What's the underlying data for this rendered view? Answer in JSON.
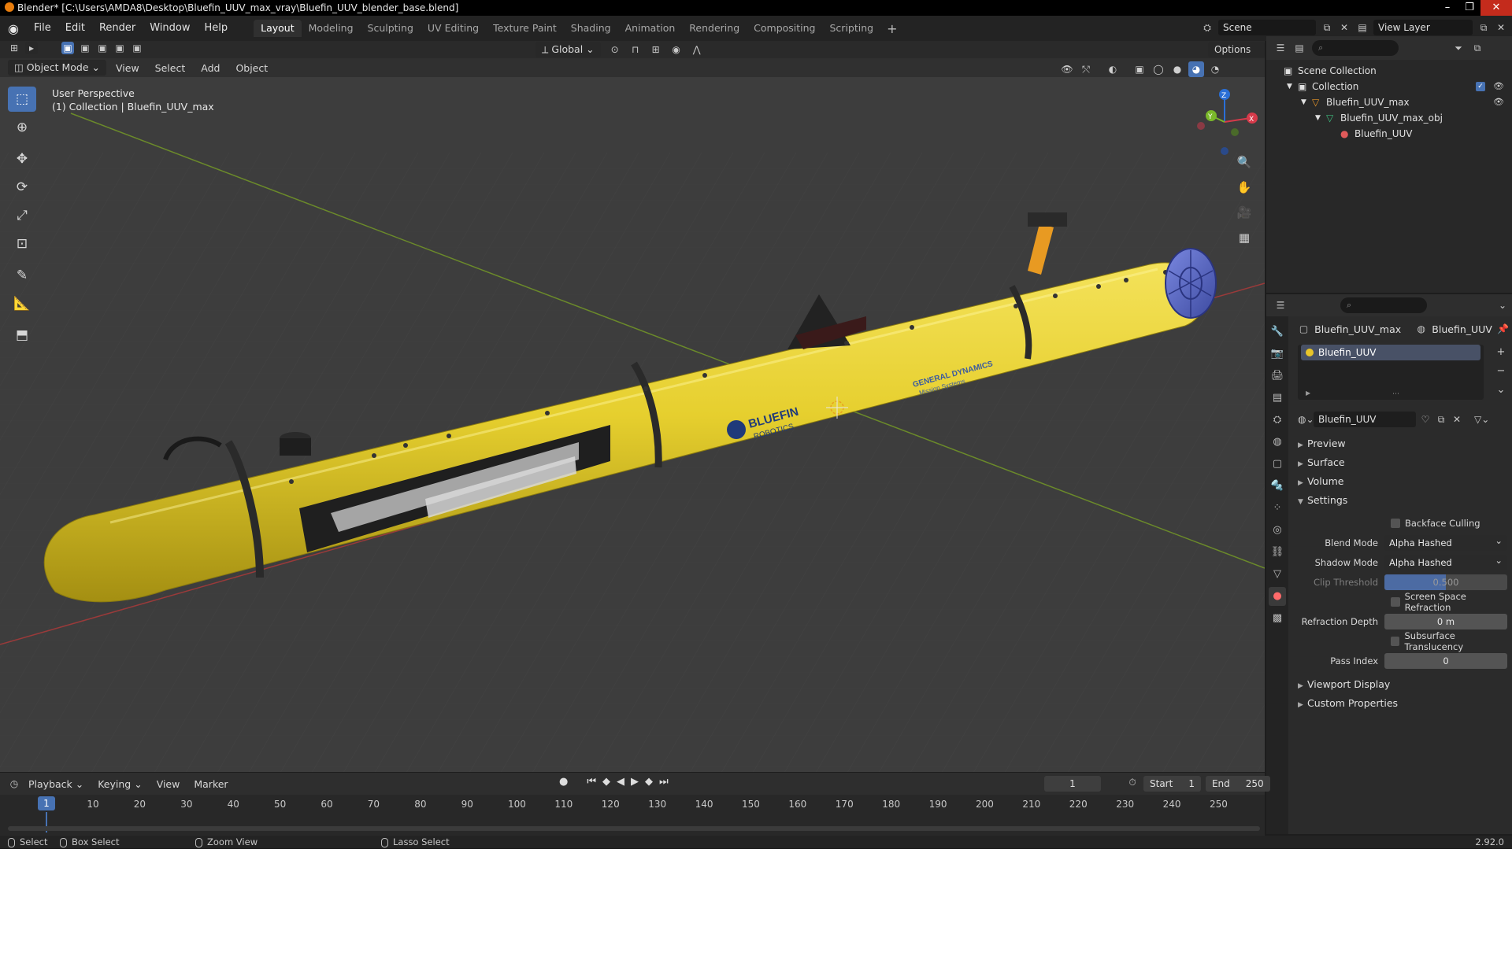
{
  "titlebar": {
    "title": "Blender* [C:\\Users\\AMDA8\\Desktop\\Bluefin_UUV_max_vray\\Bluefin_UUV_blender_base.blend]"
  },
  "menu": {
    "items": [
      "File",
      "Edit",
      "Render",
      "Window",
      "Help"
    ]
  },
  "workspaces": {
    "tabs": [
      "Layout",
      "Modeling",
      "Sculpting",
      "UV Editing",
      "Texture Paint",
      "Shading",
      "Animation",
      "Rendering",
      "Compositing",
      "Scripting"
    ],
    "add": "+"
  },
  "scene": {
    "name": "Scene",
    "view_layer": "View Layer"
  },
  "viewport": {
    "mode": "Object Mode",
    "menus": [
      "View",
      "Select",
      "Add",
      "Object"
    ],
    "orientation": "Global",
    "options": "Options",
    "title_line1": "User Perspective",
    "title_line2": "(1) Collection | Bluefin_UUV_max",
    "gizmo": {
      "x": "X",
      "y": "Y",
      "z": "Z"
    },
    "model_text": {
      "brand": "BLUEFIN",
      "brand_sub": "ROBOTICS",
      "maker": "GENERAL DYNAMICS",
      "maker_sub": "Mission Systems"
    }
  },
  "outliner": {
    "root": "Scene Collection",
    "collection": "Collection",
    "object": "Bluefin_UUV_max",
    "mesh": "Bluefin_UUV_max_obj",
    "material": "Bluefin_UUV"
  },
  "properties": {
    "breadcrumb_object": "Bluefin_UUV_max",
    "breadcrumb_material": "Bluefin_UUV",
    "slot": "Bluefin_UUV",
    "material_name": "Bluefin_UUV",
    "panels": {
      "preview": "Preview",
      "surface": "Surface",
      "volume": "Volume",
      "settings": "Settings",
      "viewport_display": "Viewport Display",
      "custom_properties": "Custom Properties"
    },
    "settings": {
      "backface_culling": "Backface Culling",
      "blend_mode_label": "Blend Mode",
      "blend_mode": "Alpha Hashed",
      "shadow_mode_label": "Shadow Mode",
      "shadow_mode": "Alpha Hashed",
      "clip_threshold_label": "Clip Threshold",
      "clip_threshold": "0.500",
      "clip_threshold_fraction": 0.5,
      "ssr": "Screen Space Refraction",
      "refraction_depth_label": "Refraction Depth",
      "refraction_depth": "0 m",
      "sss": "Subsurface Translucency",
      "pass_index_label": "Pass Index",
      "pass_index": "0"
    }
  },
  "timeline": {
    "menus": [
      "Playback",
      "Keying",
      "View",
      "Marker"
    ],
    "current_frame": "1",
    "start_label": "Start",
    "start": "1",
    "end_label": "End",
    "end": "250",
    "ticks": [
      "10",
      "20",
      "30",
      "40",
      "50",
      "60",
      "70",
      "80",
      "90",
      "100",
      "110",
      "120",
      "130",
      "140",
      "150",
      "160",
      "170",
      "180",
      "190",
      "200",
      "210",
      "220",
      "230",
      "240",
      "250"
    ]
  },
  "statusbar": {
    "select": "Select",
    "box_select": "Box Select",
    "zoom_view": "Zoom View",
    "lasso_select": "Lasso Select",
    "version": "2.92.0"
  },
  "colors": {
    "accent": "#4772b3",
    "uuv_yellow": "#e6cf2e",
    "bg_viewport": "#3a3a3a"
  }
}
